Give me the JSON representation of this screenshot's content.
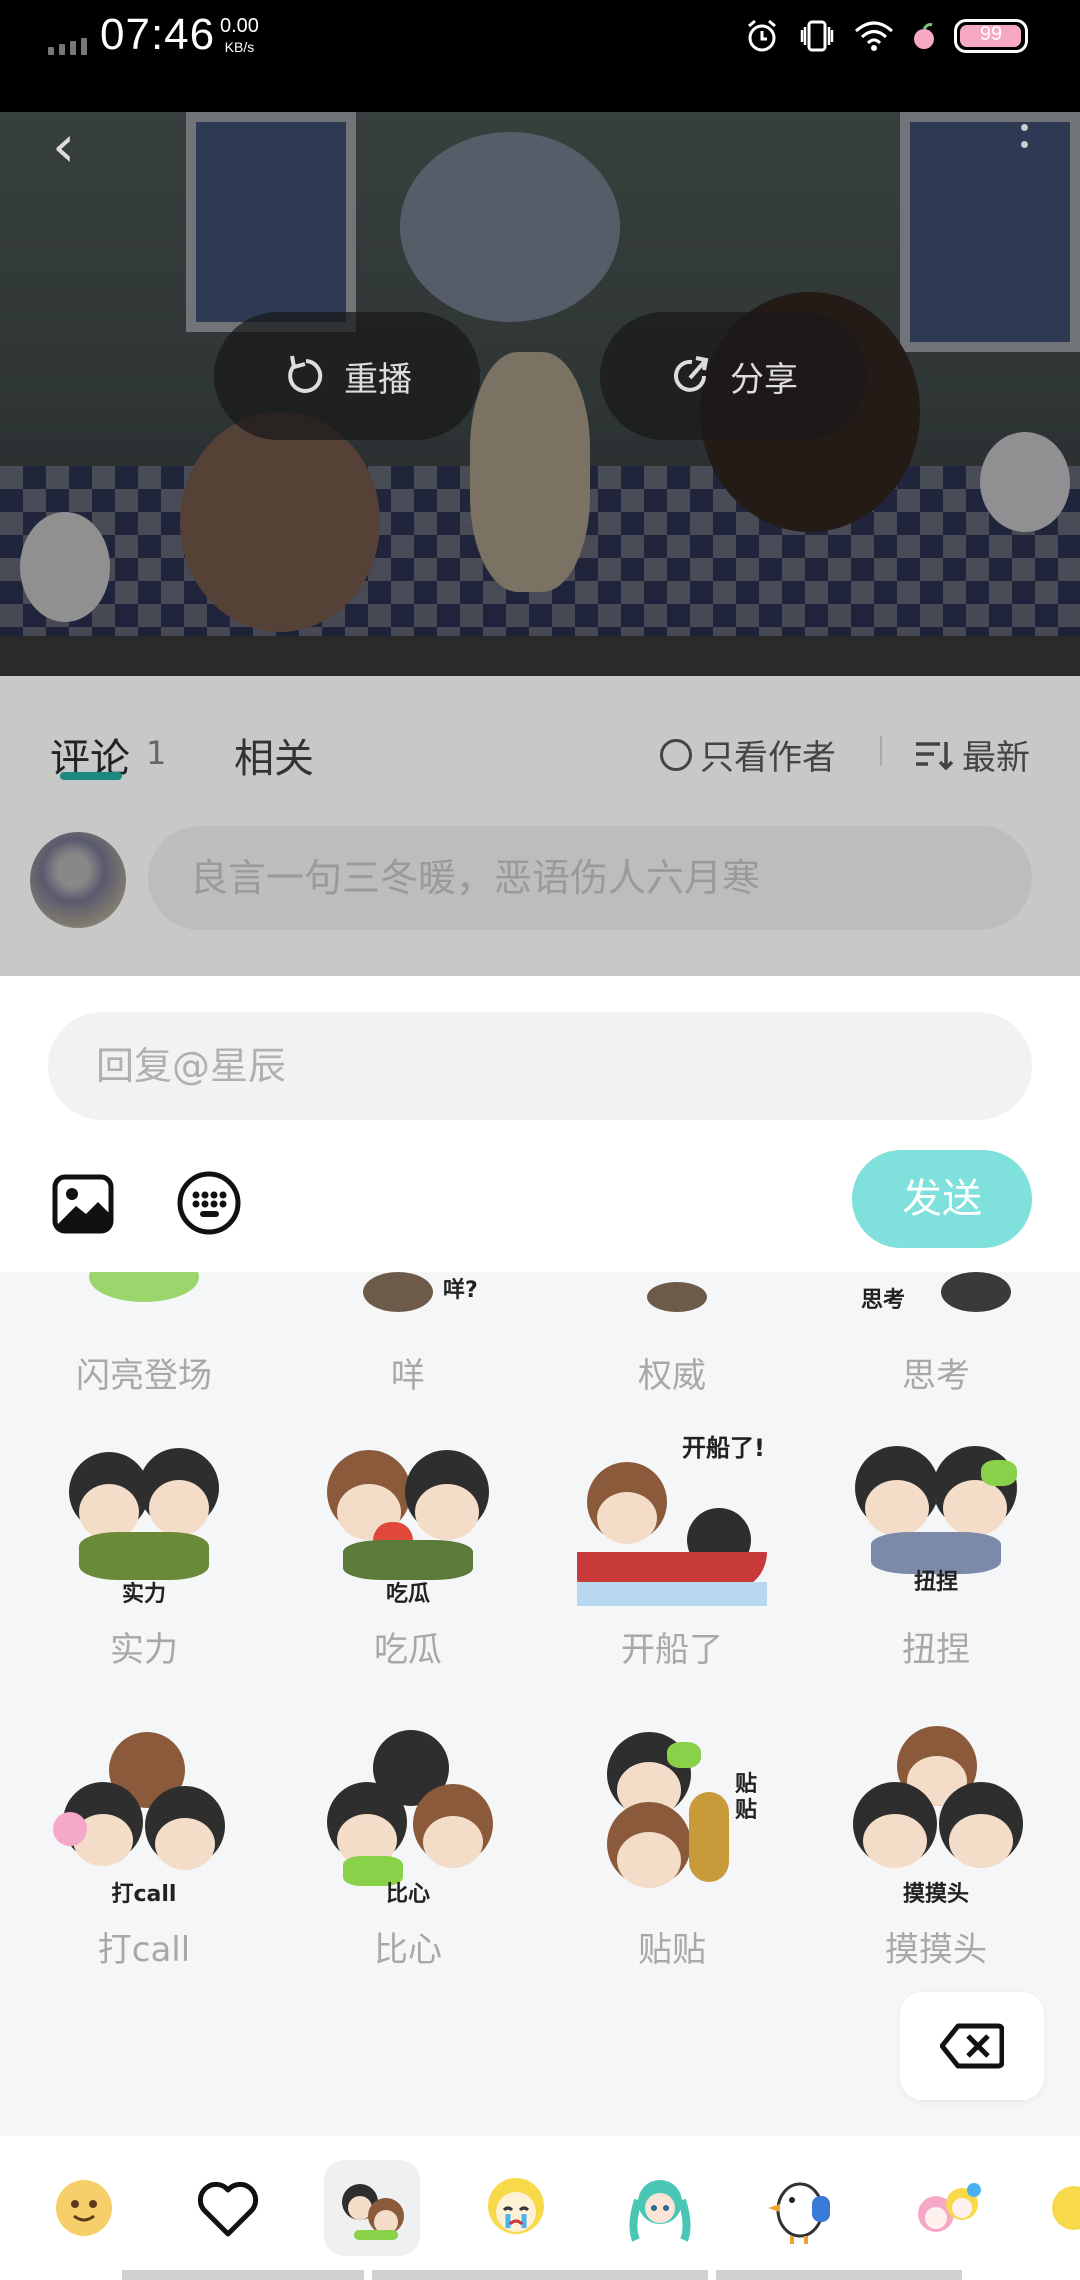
{
  "status_bar": {
    "time": "07:46",
    "net_speed": "0.00",
    "net_unit": "KB/s",
    "battery": "99",
    "battery_level": 0.99
  },
  "video": {
    "replay_label": "重播",
    "share_label": "分享"
  },
  "comments": {
    "tab_comments": "评论",
    "comment_count": "1",
    "tab_related": "相关",
    "author_only_label": "只看作者",
    "sort_label": "最新",
    "input_placeholder": "良言一句三冬暖，恶语伤人六月寒"
  },
  "reply": {
    "placeholder": "回复@星辰",
    "send_label": "发送"
  },
  "stickers": {
    "row1": [
      {
        "label": "闪亮登场"
      },
      {
        "label": "咩",
        "caption": "咩?"
      },
      {
        "label": "权威"
      },
      {
        "label": "思考",
        "caption": "思考"
      }
    ],
    "row2": [
      {
        "label": "实力",
        "caption": "实力"
      },
      {
        "label": "吃瓜",
        "caption": "吃瓜"
      },
      {
        "label": "开船了",
        "caption": "开船了!"
      },
      {
        "label": "扭捏",
        "caption": "扭捏"
      }
    ],
    "row3": [
      {
        "label": "打call",
        "caption": "打call"
      },
      {
        "label": "比心",
        "caption": "比心"
      },
      {
        "label": "贴贴",
        "caption": "贴贴"
      },
      {
        "label": "摸摸头",
        "caption": "摸摸头"
      }
    ]
  },
  "pack_tabs": [
    {
      "icon": "emoji-face-icon"
    },
    {
      "icon": "heart-icon"
    },
    {
      "icon": "chibi-pack-icon"
    },
    {
      "icon": "crying-character-icon"
    },
    {
      "icon": "miku-icon"
    },
    {
      "icon": "goose-thumbs-up-icon"
    },
    {
      "icon": "pink-characters-icon"
    },
    {
      "icon": "partial-pack-icon"
    }
  ],
  "colors": {
    "accent": "#1a8a80",
    "send_button": "#7fe0dc",
    "label_gray": "#a8a8a8"
  }
}
